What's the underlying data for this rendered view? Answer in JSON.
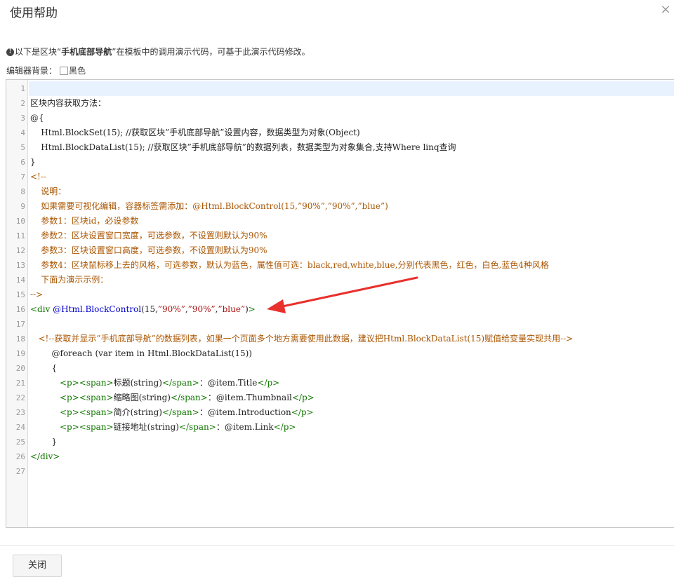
{
  "dialog": {
    "title": "使用帮助",
    "close_glyph": "×"
  },
  "notice": {
    "icon_glyph": "!",
    "prefix": "以下是区块“",
    "block_name": "手机底部导航",
    "suffix": "”在模板中的调用演示代码，可基于此演示代码修改。"
  },
  "editor_bg": {
    "label": "编辑器背景：",
    "option": "黑色"
  },
  "code_lines": [
    "1",
    "2",
    "3",
    "4",
    "5",
    "6",
    "7",
    "8",
    "9",
    "10",
    "11",
    "12",
    "13",
    "14",
    "15",
    "16",
    "17",
    "18",
    "19",
    "20",
    "21",
    "22",
    "23",
    "24",
    "25",
    "26",
    "27"
  ],
  "code": {
    "l2": "区块内容获取方法：",
    "l3": "@{",
    "l4": "    Html.BlockSet(15); //获取区块”手机底部导航”设置内容，数据类型为对象(Object)",
    "l5": "    Html.BlockDataList(15); //获取区块”手机底部导航”的数据列表，数据类型为对象集合,支持Where linq查询",
    "l6": "}",
    "l7": "<!--",
    "l8": "    说明：",
    "l9": "    如果需要可视化编辑，容器标签需添加：@Html.BlockControl(15,”90%”,”90%”,”blue”)",
    "l10": "    参数1：区块id，必设参数",
    "l11": "    参数2：区块设置窗口宽度，可选参数，不设置则默认为90%",
    "l12": "    参数3：区块设置窗口高度，可选参数，不设置则默认为90%",
    "l13": "    参数4：区块鼠标移上去的风格，可选参数，默认为蓝色，属性值可选：black,red,white,blue,分别代表黑色，红色，白色,蓝色4种风格",
    "l14": "    下面为演示示例：",
    "l15": "-->",
    "l16_tag_open": "<div",
    "l16_attr": " @Html.BlockControl",
    "l16_args_open": "(15,",
    "l16_s1": "”90%”",
    "l16_comma1": ",",
    "l16_s2": "”90%”",
    "l16_comma2": ",",
    "l16_s3": "”blue”",
    "l16_args_close": ")",
    "l16_tag_close": ">",
    "l18": "   <!--获取并显示”手机底部导航”的数据列表，如果一个页面多个地方需要使用此数据，建议把Html.BlockDataList(15)赋值给变量实现共用-->",
    "l19": "        @foreach (var item in Html.BlockDataList(15))",
    "l20": "        {",
    "l21_indent": "           ",
    "l21_p_open": "<p>",
    "l21_span_open": "<span>",
    "l21_label": "标题(string)",
    "l21_span_close": "</span>",
    "l21_value": "：@item.Title",
    "l21_p_close": "</p>",
    "l22_indent": "           ",
    "l22_p_open": "<p>",
    "l22_span_open": "<span>",
    "l22_label": "缩略图(string)",
    "l22_span_close": "</span>",
    "l22_value": "：@item.Thumbnail",
    "l22_p_close": "</p>",
    "l23_indent": "           ",
    "l23_p_open": "<p>",
    "l23_span_open": "<span>",
    "l23_label": "简介(string)",
    "l23_span_close": "</span>",
    "l23_value": "：@item.Introduction",
    "l23_p_close": "</p>",
    "l24_indent": "           ",
    "l24_p_open": "<p>",
    "l24_span_open": "<span>",
    "l24_label": "链接地址(string)",
    "l24_span_close": "</span>",
    "l24_value": "：@item.Link",
    "l24_p_close": "</p>",
    "l25": "        }",
    "l26": "</div>"
  },
  "footer": {
    "close_label": "关闭"
  },
  "colors": {
    "comment": "#aa5500",
    "tag": "#117700",
    "string": "#aa1111",
    "attribute": "#0000cc",
    "arrow": "#e8302c"
  }
}
